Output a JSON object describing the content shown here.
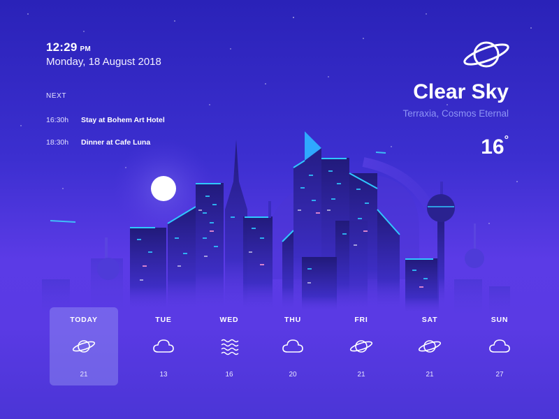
{
  "clock": {
    "time": "12:29",
    "ampm": "PM",
    "date": "Monday, 18 August 2018"
  },
  "agenda": {
    "label": "NEXT",
    "events": [
      {
        "time": "16:30h",
        "name": "Stay at Bohem Art Hotel"
      },
      {
        "time": "18:30h",
        "name": "Dinner at Cafe Luna"
      }
    ]
  },
  "weather": {
    "condition": "Clear Sky",
    "location": "Terraxia, Cosmos Eternal",
    "temperature": "16",
    "degree": "°",
    "icon": "planet-icon"
  },
  "forecast": [
    {
      "day": "TODAY",
      "icon": "planet-icon",
      "temp": "21",
      "active": true
    },
    {
      "day": "TUE",
      "icon": "cloud-icon",
      "temp": "13"
    },
    {
      "day": "WED",
      "icon": "waves-icon",
      "temp": "16"
    },
    {
      "day": "THU",
      "icon": "cloud-icon",
      "temp": "20"
    },
    {
      "day": "FRI",
      "icon": "planet-icon",
      "temp": "21"
    },
    {
      "day": "SAT",
      "icon": "planet-icon",
      "temp": "21"
    },
    {
      "day": "SUN",
      "icon": "cloud-icon",
      "temp": "27"
    }
  ],
  "colors": {
    "accent": "#2fc8ff",
    "location_text": "#8e94f5",
    "background": "#3c2fd0"
  }
}
